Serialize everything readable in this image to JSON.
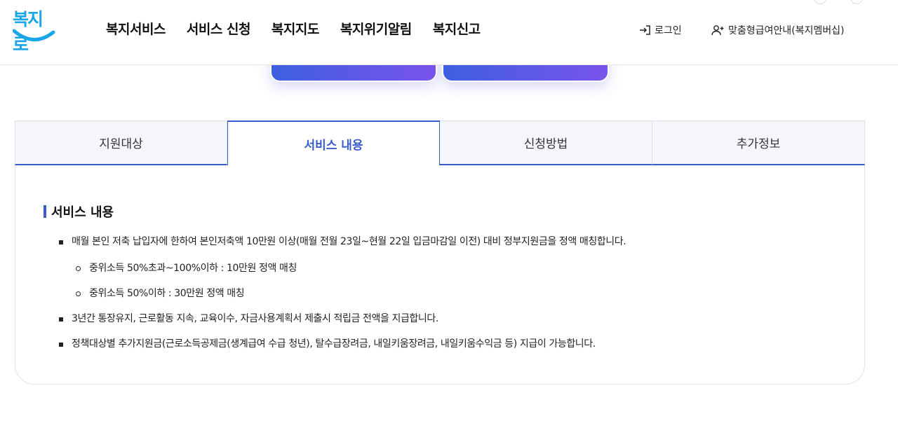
{
  "header": {
    "logo_text": "복지로",
    "nav": [
      "복지서비스",
      "서비스 신청",
      "복지지도",
      "복지위기알림",
      "복지신고"
    ],
    "login_label": "로그인",
    "member_label": "맞춤형급여안내(복지멤버십)",
    "icons": {
      "login": "login-arrow-icon",
      "member": "user-plus-icon"
    }
  },
  "tabs": [
    {
      "label": "지원대상",
      "active": false
    },
    {
      "label": "서비스 내용",
      "active": true
    },
    {
      "label": "신청방법",
      "active": false
    },
    {
      "label": "추가정보",
      "active": false
    }
  ],
  "section": {
    "title": "서비스 내용",
    "items": [
      {
        "text": "매월 본인 저축 납입자에 한하여 본인저축액 10만원 이상(매월 전월 23일~현월 22일 입금마감일 이전) 대비 정부지원금을 정액 매칭합니다.",
        "sub": [
          "중위소득 50%초과~100%이하 : 10만원 정액 매칭",
          "중위소득 50%이하 : 30만원 정액 매칭"
        ]
      },
      {
        "text": "3년간 통장유지, 근로활동 지속, 교육이수, 자금사용계획서 제출시 적립금 전액을 지급합니다."
      },
      {
        "text": "정책대상별 추가지원금(근로소득공제금(생계급여 수급 청년), 탈수급장려금, 내일키움장려금, 내일키움수익금 등) 지급이 가능합니다."
      }
    ]
  },
  "colors": {
    "accent": "#3b5ccd",
    "logo": "#1aa6e8",
    "gradient_start": "#3d5fe0",
    "gradient_end": "#7a54ec"
  }
}
